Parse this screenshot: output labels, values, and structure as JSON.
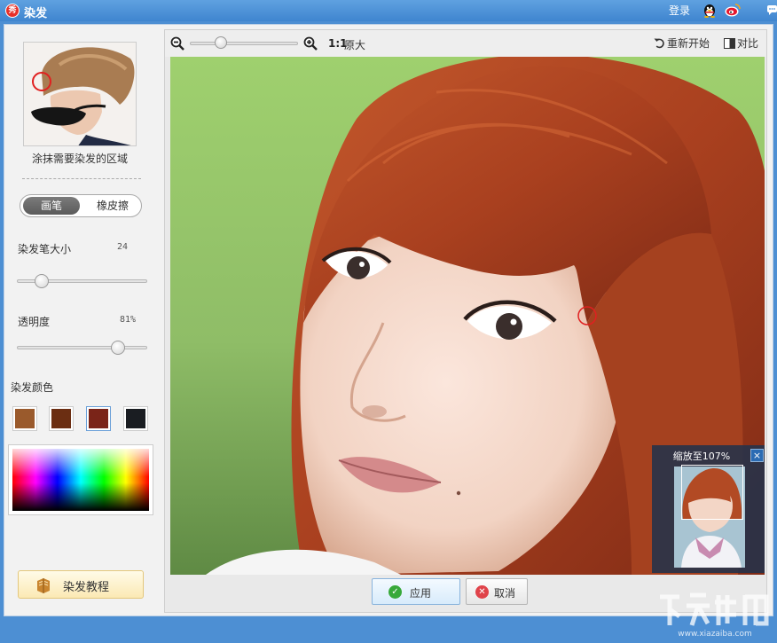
{
  "titlebar": {
    "title": "染发",
    "logo_char": "秀",
    "login": "登录",
    "icons": [
      "qq-penguin-icon",
      "weibo-icon",
      "message-icon"
    ]
  },
  "left_panel": {
    "hint": "涂抹需要染发的区域",
    "tools": {
      "brush": "画笔",
      "eraser": "橡皮擦",
      "selected": "brush"
    },
    "brush_size": {
      "label": "染发笔大小",
      "value": "24",
      "fraction": 0.15
    },
    "opacity": {
      "label": "透明度",
      "value": "81%",
      "fraction": 0.81
    },
    "color_label": "染发颜色",
    "swatches": [
      {
        "name": "light-brown",
        "color": "#9a5a2c"
      },
      {
        "name": "dark-brown",
        "color": "#6b2e12"
      },
      {
        "name": "wine-red",
        "color": "#7a2418",
        "selected": true
      },
      {
        "name": "black",
        "color": "#1a1d22"
      }
    ],
    "tutorial": "染发教程"
  },
  "toolbar": {
    "one_to_one": "1:1",
    "original": "原大",
    "reset": "重新开始",
    "compare": "对比",
    "zoom_fraction": 0.26
  },
  "navigator": {
    "title": "缩放至107%",
    "close": "×"
  },
  "actions": {
    "apply": "应用",
    "cancel": "取消"
  },
  "colors": {
    "titlebar": "#4a8fd6",
    "hair": "#b14a26",
    "background_green": "#a9d57a"
  }
}
